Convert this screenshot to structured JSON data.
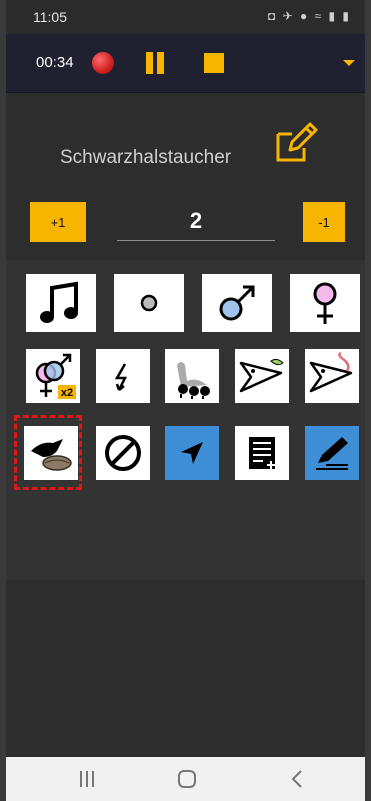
{
  "status_bar": {
    "time": "11:05",
    "icons": "◘ ✈ ● ≈ ▮ ▮"
  },
  "toolbar": {
    "elapsed": "00:34"
  },
  "species": {
    "name": "Schwarzhalstaucher"
  },
  "counter": {
    "increment_label": "+1",
    "value": "2",
    "decrement_label": "-1"
  },
  "grid": {
    "tiles": [
      "song-icon",
      "call-icon",
      "male-icon",
      "female-icon",
      "pair-x2-icon",
      "flight-icon",
      "family-icon",
      "fish-prey-icon",
      "worm-prey-icon",
      "nesting-icon",
      "no-icon",
      "location-arrow-icon",
      "notes-icon",
      "edit-entry-icon"
    ],
    "pair_badge": "x2"
  },
  "colors": {
    "accent": "#f7b500",
    "blue_tile": "#3f8fd6",
    "highlight": "#e01515"
  }
}
